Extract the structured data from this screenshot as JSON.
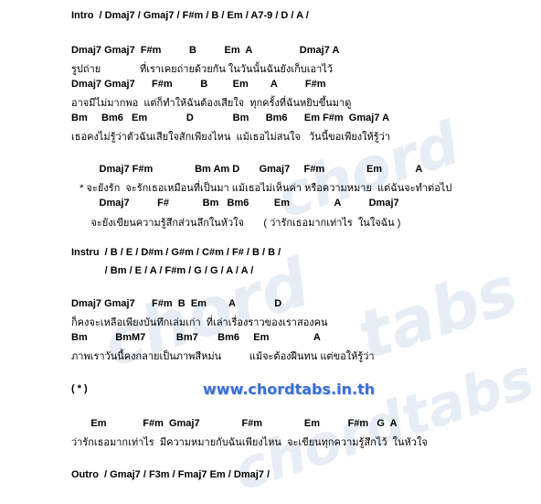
{
  "watermark": "chordtabs",
  "lines": {
    "intro": "Intro  / Dmaj7 / Gmaj7 / F#m / B / Em / A7-9 / D / A /",
    "v1_c1": "Dmaj7 Gmaj7  F#m          B          Em  A                 Dmaj7 A",
    "v1_l1": "รูปถ่าย              ที่เราเคยถ่ายด้วยกัน ในวันนั้นฉันยังเก็บเอาไว้",
    "v1_c2": "Dmaj7 Gmaj7      F#m          B         Em        A          F#m",
    "v1_l2": "อาจมีไม่มากพอ  แต่ก็ทำให้ฉันต้องเสียใจ  ทุกครั้งที่ฉันหยิบขึ้นมาดู",
    "v1_c3": "Bm     Bm6   Em              D              Bm      Bm6      Em F#m  Gmaj7 A",
    "v1_l3": "เธอคงไม่รู้ว่าตัวฉันเสียใจสักเพียงไหน  แม้เธอไม่สนใจ   วันนี้ขอเพียงให้รู้ว่า",
    "ch_c1": "          Dmaj7 F#m               Bm Am D       Gmaj7     F#m               Em            A",
    "ch_l1": "   * จะยังรัก  จะรักเธอเหมือนที่เป็นมา แม้เธอไม่เห็นค่า หรือความหมาย  แต่ฉันจะทำต่อไป",
    "ch_c2": "          Dmaj7          F#            Bm   Bm6         Em                A          Dmaj7",
    "ch_l2": "       จะยังเขียนความรู้สึกส่วนลึกในหัวใจ       ( ว่ารักเธอมากเท่าไร  ในใจฉัน )",
    "instru1": "Instru  / B / E / D#m / G#m / C#m / F# / B / B /",
    "instru2": "            / Bm / E / A / F#m / G / G / A / A /",
    "v2_c1": "Dmaj7 Gmaj7      F#m  B  Em        A              D",
    "v2_l1": "ก็คงจะเหลือเพียงบันทึกเล่มเก่า  ที่เล่าเรื่องราวของเราสองคน",
    "v2_c2": "Bm          BmM7           Bm7       Bm6     Em                A",
    "v2_l2": "ภาพเราวันนี้คงกลายเป็นภาพสีหม่น          แม้จะต้องฝืนทน แต่ขอให้รู้ว่า",
    "rep": "( * )",
    "url": "www.chordtabs.in.th",
    "end_c": "       Em             F#m  Gmaj7               F#m               Em          F#m   G  A",
    "end_l": "ว่ารักเธอมากเท่าไร  มีความหมายกับฉันเพียงไหน  จะเขียนทุกความรู้สึกไว้  ในหัวใจ",
    "outro": "Outro  / Gmaj7 / F3m / Fmaj7 Em / Dmaj7 /"
  }
}
